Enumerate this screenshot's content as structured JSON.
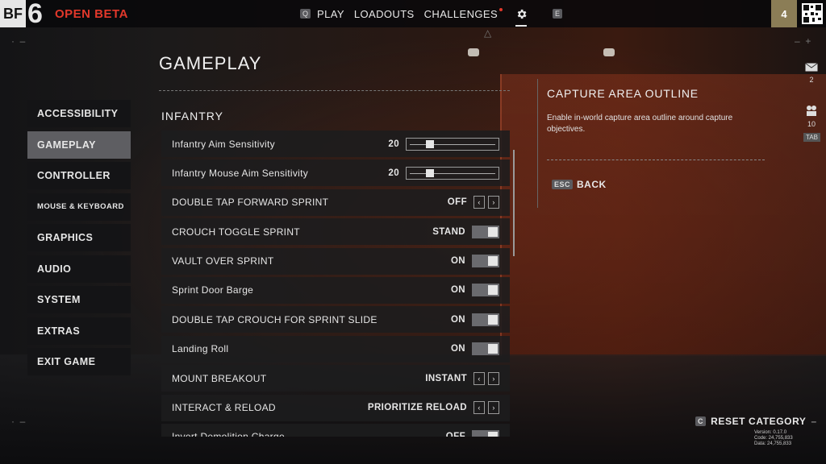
{
  "brand": {
    "logo_text": "BF",
    "logo_number": "6",
    "subtitle": "OPEN BETA"
  },
  "nav": {
    "key_left": "Q",
    "items": [
      {
        "label": "PLAY"
      },
      {
        "label": "LOADOUTS"
      },
      {
        "label": "CHALLENGES"
      }
    ],
    "key_right": "E"
  },
  "player": {
    "level": "4"
  },
  "page": {
    "title": "GAMEPLAY",
    "section": "INFANTRY"
  },
  "sidebar": {
    "items": [
      {
        "label": "ACCESSIBILITY"
      },
      {
        "label": "GAMEPLAY"
      },
      {
        "label": "CONTROLLER"
      },
      {
        "label": "MOUSE & KEYBOARD"
      },
      {
        "label": "GRAPHICS"
      },
      {
        "label": "AUDIO"
      },
      {
        "label": "SYSTEM"
      },
      {
        "label": "EXTRAS"
      },
      {
        "label": "EXIT GAME"
      }
    ]
  },
  "settings": [
    {
      "label": "Infantry Aim Sensitivity",
      "value": "20",
      "control": "slider",
      "level": 0.2
    },
    {
      "label": "Infantry Mouse Aim Sensitivity",
      "value": "20",
      "control": "slider",
      "level": 0.2
    },
    {
      "label": "DOUBLE TAP FORWARD SPRINT",
      "value": "OFF",
      "control": "arrows"
    },
    {
      "label": "CROUCH TOGGLE SPRINT",
      "value": "STAND",
      "control": "toggle"
    },
    {
      "label": "VAULT OVER SPRINT",
      "value": "ON",
      "control": "toggle"
    },
    {
      "label": "Sprint Door Barge",
      "value": "ON",
      "control": "toggle"
    },
    {
      "label": "DOUBLE TAP CROUCH FOR SPRINT SLIDE",
      "value": "ON",
      "control": "toggle"
    },
    {
      "label": "Landing Roll",
      "value": "ON",
      "control": "toggle"
    },
    {
      "label": "MOUNT BREAKOUT",
      "value": "INSTANT",
      "control": "arrows"
    },
    {
      "label": "INTERACT & RELOAD",
      "value": "PRIORITIZE RELOAD",
      "control": "arrows"
    },
    {
      "label": "Invert Demolition Charge",
      "value": "OFF",
      "control": "toggle"
    }
  ],
  "info": {
    "title": "CAPTURE AREA OUTLINE",
    "description": "Enable in-world capture area outline around capture objectives.",
    "back_key": "ESC",
    "back_label": "BACK"
  },
  "rail": {
    "mail_count": "2",
    "friends_count": "10",
    "tab_key": "TAB"
  },
  "footer": {
    "reset_key": "C",
    "reset_label": "RESET CATEGORY",
    "version_line1": "Version: 0.17.0",
    "version_line2": "Code: 24,755,833",
    "version_line3": "Data: 24,755,833"
  },
  "colors": {
    "accent_red": "#e2382b",
    "active_item": "#5e5e62",
    "player_badge": "#8b7d56"
  }
}
